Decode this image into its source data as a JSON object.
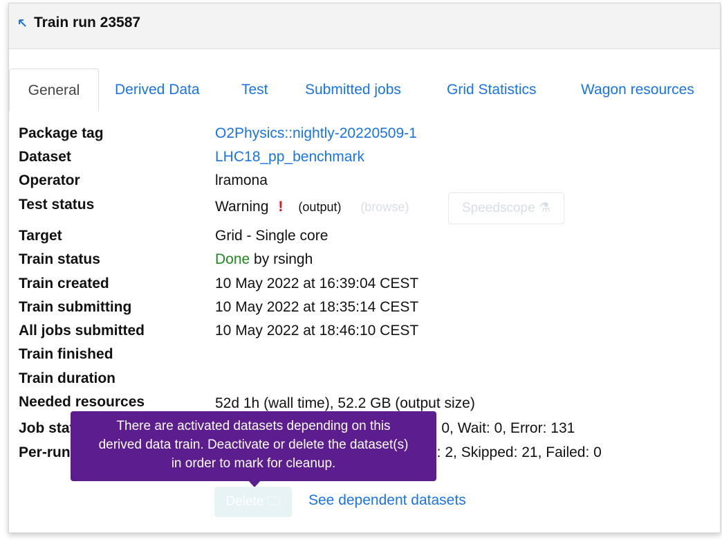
{
  "header": {
    "title": "Train run 23587"
  },
  "tabs": [
    {
      "label": "General"
    },
    {
      "label": "Derived Data"
    },
    {
      "label": "Test"
    },
    {
      "label": "Submitted jobs"
    },
    {
      "label": "Grid Statistics"
    },
    {
      "label": "Wagon resources"
    }
  ],
  "fields": {
    "package_tag": {
      "label": "Package tag",
      "value": "O2Physics::nightly-20220509-1"
    },
    "dataset": {
      "label": "Dataset",
      "value": "LHC18_pp_benchmark"
    },
    "operator": {
      "label": "Operator",
      "value": "lramona"
    },
    "test_status": {
      "label": "Test status",
      "value": "Warning",
      "mark": "!",
      "output": "(output)",
      "browse": "(browse)",
      "speedscope": "Speedscope"
    },
    "target": {
      "label": "Target",
      "value": "Grid - Single core"
    },
    "train_status": {
      "label": "Train status",
      "status": "Done",
      "by": "by",
      "user": "rsingh"
    },
    "train_created": {
      "label": "Train created",
      "value": "10 May 2022 at 16:39:04 CEST"
    },
    "train_submitting": {
      "label": "Train submitting",
      "value": "10 May 2022 at 18:35:14 CEST"
    },
    "all_jobs_submitted": {
      "label": "All jobs submitted",
      "value": "10 May 2022 at 18:46:10 CEST"
    },
    "train_finished": {
      "label": "Train finished",
      "value": ""
    },
    "train_duration": {
      "label": "Train duration",
      "value": ""
    },
    "needed_resources": {
      "label": "Needed resources",
      "value": "52d 1h (wall time), 52.2 GB (output size)"
    },
    "job_status": {
      "label": "Job status",
      "value": "tive: 0, Wait: 0, Error: 131"
    },
    "per_run_merging": {
      "label": "Per-run merging",
      "value": "g: 2, Skipped: 21, Failed: 0"
    }
  },
  "tooltip": {
    "line1": "There are activated datasets depending on this",
    "line2": "derived data train. Deactivate or delete the dataset(s)",
    "line3": "in order to mark for cleanup."
  },
  "actions": {
    "delete_label": "Delete",
    "dependent_link": "See dependent datasets"
  }
}
